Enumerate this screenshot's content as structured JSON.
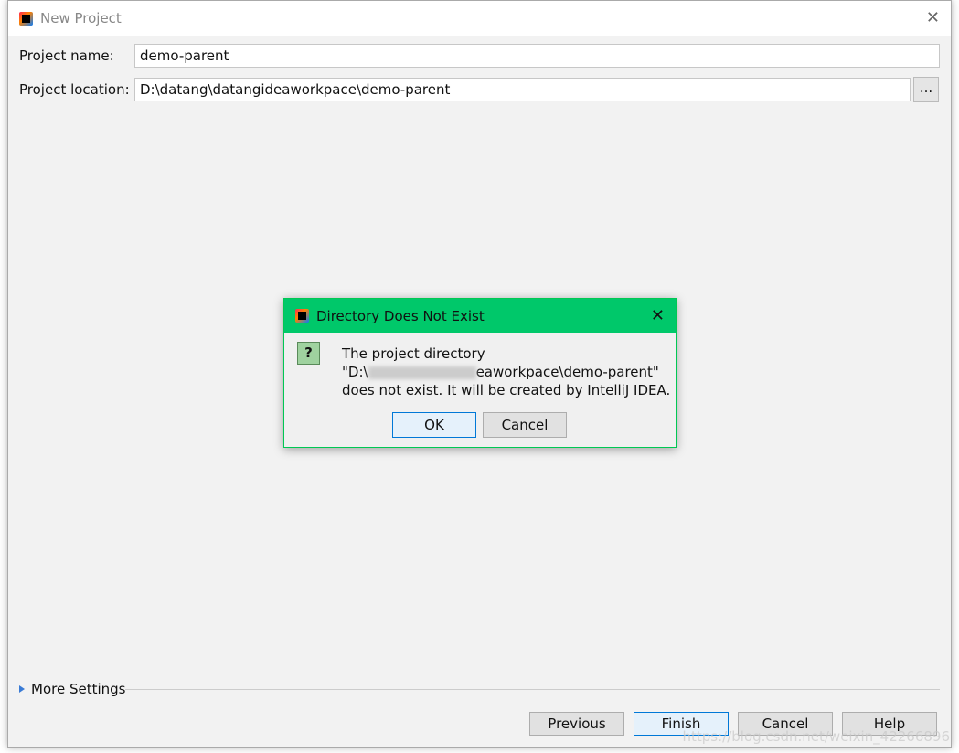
{
  "window": {
    "title": "New Project",
    "close_icon": "close-icon"
  },
  "form": {
    "project_name_label": "Project name:",
    "project_name_value": "demo-parent",
    "project_location_label": "Project location:",
    "project_location_value": "D:\\datang\\datangideaworkpace\\demo-parent",
    "browse_label": "..."
  },
  "more_settings": "More Settings",
  "buttons": {
    "previous": "Previous",
    "finish": "Finish",
    "cancel": "Cancel",
    "help": "Help"
  },
  "dialog": {
    "title": "Directory Does Not Exist",
    "title_color": "#00c86a",
    "line1": "The project directory",
    "line2_prefix": "\"D:\\",
    "line2_suffix": "eaworkpace\\demo-parent\"",
    "line3": "does not exist. It will be created by IntelliJ IDEA.",
    "ok": "OK",
    "cancel": "Cancel",
    "icon": "question-icon"
  },
  "watermark": "https://blog.csdn.net/weixin_42266896"
}
